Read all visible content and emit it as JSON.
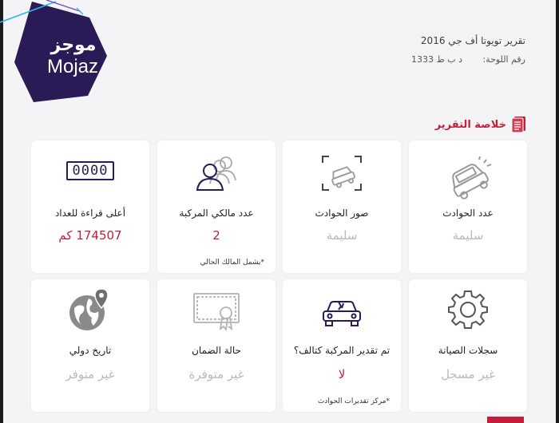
{
  "logo": {
    "arabic": "موجز",
    "english": "Mojaz"
  },
  "header": {
    "report_title": "تقرير تويوتا أف جي 2016",
    "plate_label": "رقم اللوحة:",
    "plate_value": "د ب ط 1333"
  },
  "summary": {
    "title": "خلاصة التقرير"
  },
  "cards": [
    {
      "label": "عدد الحوادث",
      "value": "سليمة",
      "icon": "crashed-car-icon"
    },
    {
      "label": "صور الحوادث",
      "value": "سليمة",
      "icon": "accident-photo-icon"
    },
    {
      "label": "عدد مالكي المركبة",
      "value": "2",
      "note": "*يشمل المالك الحالي",
      "icon": "owners-icon"
    },
    {
      "label": "أعلى قراءة للعداد",
      "value": "174507 كم",
      "icon": "odometer-icon",
      "odometer_digits": "0000"
    },
    {
      "label": "سجلات الصيانة",
      "value": "غير مسجل",
      "icon": "gear-icon"
    },
    {
      "label": "تم تقدير المركبة كتالف؟",
      "value": "لا",
      "note": "*مركز تقديرات الحوادث",
      "icon": "damaged-car-icon"
    },
    {
      "label": "حالة الضمان",
      "value": "غير متوفرة",
      "icon": "warranty-certificate-icon"
    },
    {
      "label": "تاريخ دولي",
      "value": "غير متوفر",
      "icon": "globe-location-icon"
    }
  ],
  "colors": {
    "brand": "#2a1a55",
    "accent": "#c0203a",
    "muted": "#b9b9bf"
  }
}
